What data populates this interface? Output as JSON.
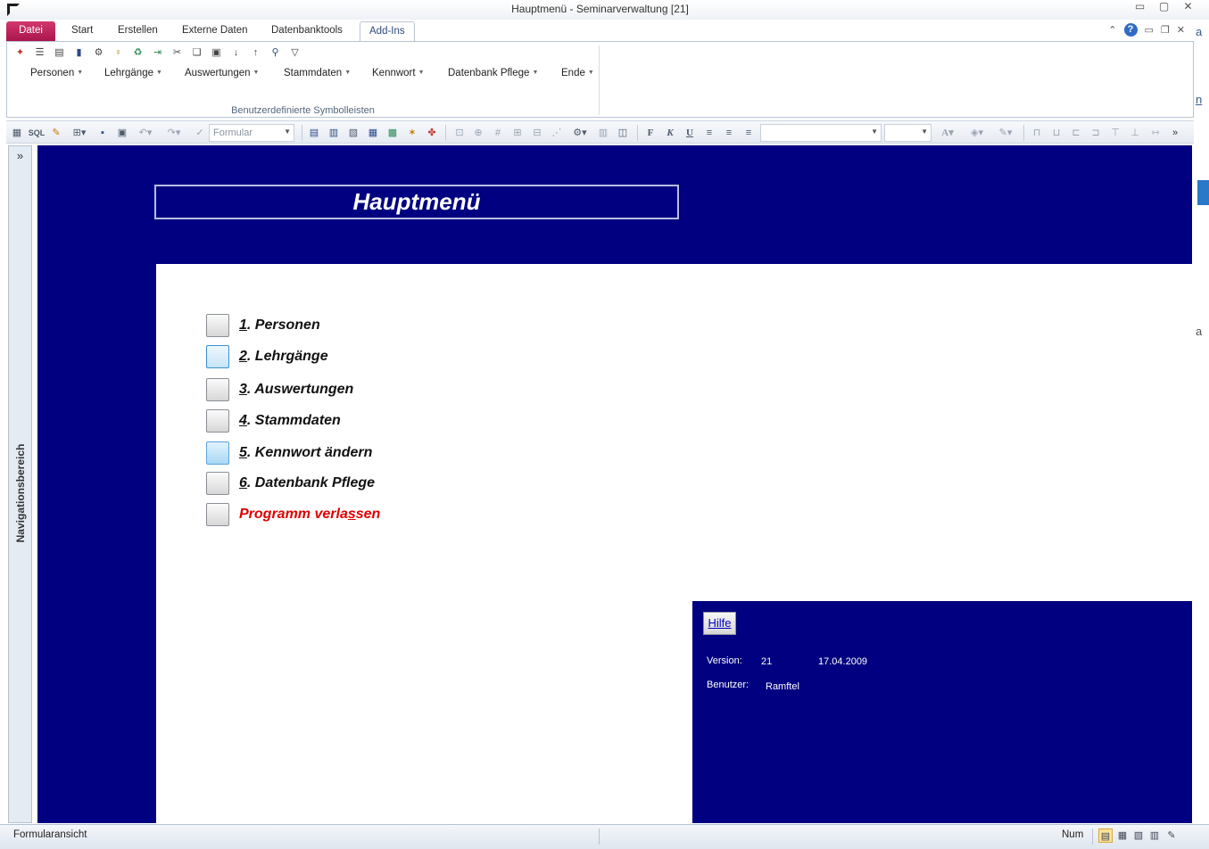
{
  "window": {
    "title": "Hauptmenü  -  Seminarverwaltung [21]",
    "controls": [
      "▭",
      "▢",
      "✕"
    ]
  },
  "ribbon": {
    "tabs": [
      "Datei",
      "Start",
      "Erstellen",
      "Externe Daten",
      "Datenbanktools",
      "Add-Ins"
    ],
    "active_tab": "Add-Ins",
    "menus": [
      "Personen",
      "Lehrgänge",
      "Auswertungen",
      "Stammdaten",
      "Kennwort",
      "Ende"
    ],
    "menus_extra": "Datenbank Pflege",
    "group_label": "Benutzerdefinierte Symbolleisten"
  },
  "toolbar": {
    "sql_label": "SQL",
    "object_combo": "Formular",
    "bold": "F",
    "italic": "K",
    "underline": "U",
    "font_color": "A"
  },
  "nav": {
    "label": "Navigationsbereich",
    "toggle": "»"
  },
  "form": {
    "title": "Hauptmenü",
    "items": [
      {
        "key": "1",
        "text": ". Personen"
      },
      {
        "key": "2",
        "text": ". Lehrgänge"
      },
      {
        "key": "3",
        "text": ". Auswertungen"
      },
      {
        "key": "4",
        "text": ". Stammdaten"
      },
      {
        "key": "5",
        "text": ". Kennwort ändern"
      },
      {
        "key": "6",
        "text": ". Datenbank Pflege"
      }
    ],
    "exit": {
      "before": "Programm verla",
      "key": "s",
      "after": "sen"
    },
    "info": {
      "help_button": "Hilfe",
      "version_label": "Version:",
      "version_value": "21",
      "date": "17.04.2009",
      "user_label": "Benutzer:",
      "user_value": "Ramftel"
    }
  },
  "status": {
    "view": "Formularansicht",
    "num": "Num"
  },
  "colors": {
    "form_background": "#000080",
    "exit_text": "#e00000",
    "file_tab": "#b81d57"
  }
}
